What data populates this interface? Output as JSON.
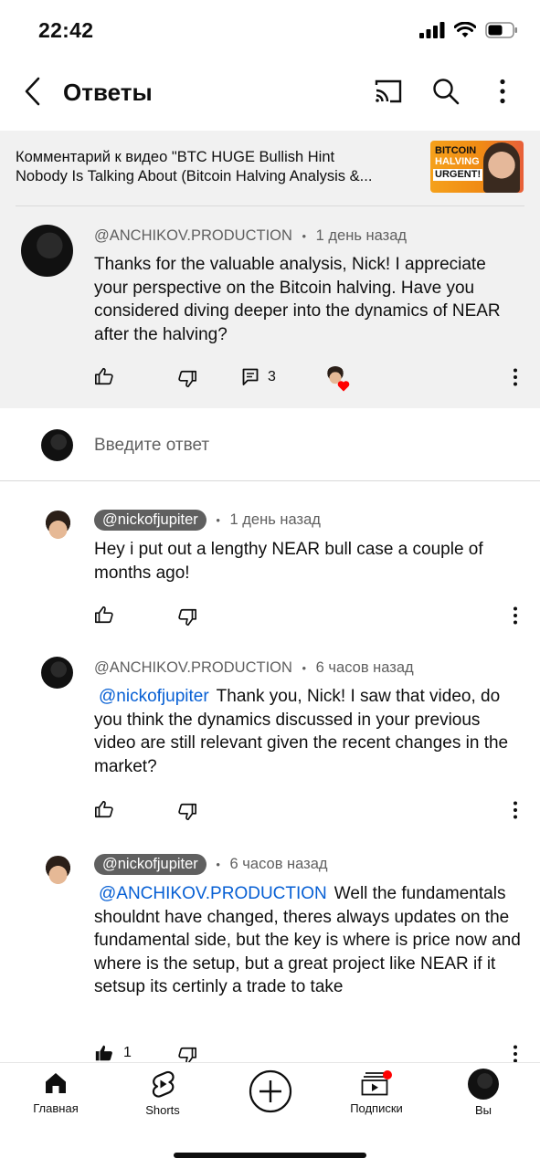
{
  "status_bar": {
    "time": "22:42"
  },
  "header": {
    "title": "Ответы"
  },
  "video_ref": {
    "line1": "Комментарий к видео \"BTC HUGE Bullish Hint",
    "line2": "Nobody Is Talking About (Bitcoin Halving Analysis &...",
    "thumb_line1": "BITCOIN",
    "thumb_line2": "HALVING",
    "thumb_line3": "URGENT!"
  },
  "main_comment": {
    "author": "@ANCHIKOV.PRODUCTION",
    "time": "1 день назад",
    "text": "Thanks for the valuable analysis, Nick! I appreciate your perspective on the Bitcoin halving. Have you considered diving deeper into the dynamics of NEAR after the halving?",
    "reply_count": "3"
  },
  "reply_input": {
    "placeholder": "Введите ответ"
  },
  "replies": [
    {
      "author": "@nickofjupiter",
      "time": "1 день назад",
      "mention": "",
      "text": "Hey i put out a lengthy NEAR bull case a couple of months ago!",
      "likes": ""
    },
    {
      "author": "@ANCHIKOV.PRODUCTION",
      "time": "6 часов назад",
      "mention": "@nickofjupiter",
      "text": "Thank you, Nick! I saw that video, do you think the dynamics discussed in your previous video are still relevant given the recent changes in the market?",
      "likes": ""
    },
    {
      "author": "@nickofjupiter",
      "time": "6 часов назад",
      "mention": "@ANCHIKOV.PRODUCTION",
      "text": "Well the fundamentals shouldnt have changed, theres always updates on the fundamental side, but the key is where is price now and where is the setup, but a great project like NEAR if it setsup its certinly a trade to take",
      "likes": "1"
    }
  ],
  "separator": "•",
  "bottom_nav": {
    "home": "Главная",
    "shorts": "Shorts",
    "subscriptions": "Подписки",
    "you": "Вы"
  },
  "colors": {
    "accent_blue": "#065fd4",
    "like_red": "#ff0000",
    "highlight_bg": "#f1f1f1"
  },
  "icons": [
    "back-arrow-icon",
    "cast-icon",
    "search-icon",
    "more-vert-icon",
    "thumb-up-icon",
    "thumb-down-icon",
    "reply-icon",
    "heart-icon",
    "home-icon",
    "shorts-icon",
    "create-icon",
    "subscriptions-icon"
  ]
}
